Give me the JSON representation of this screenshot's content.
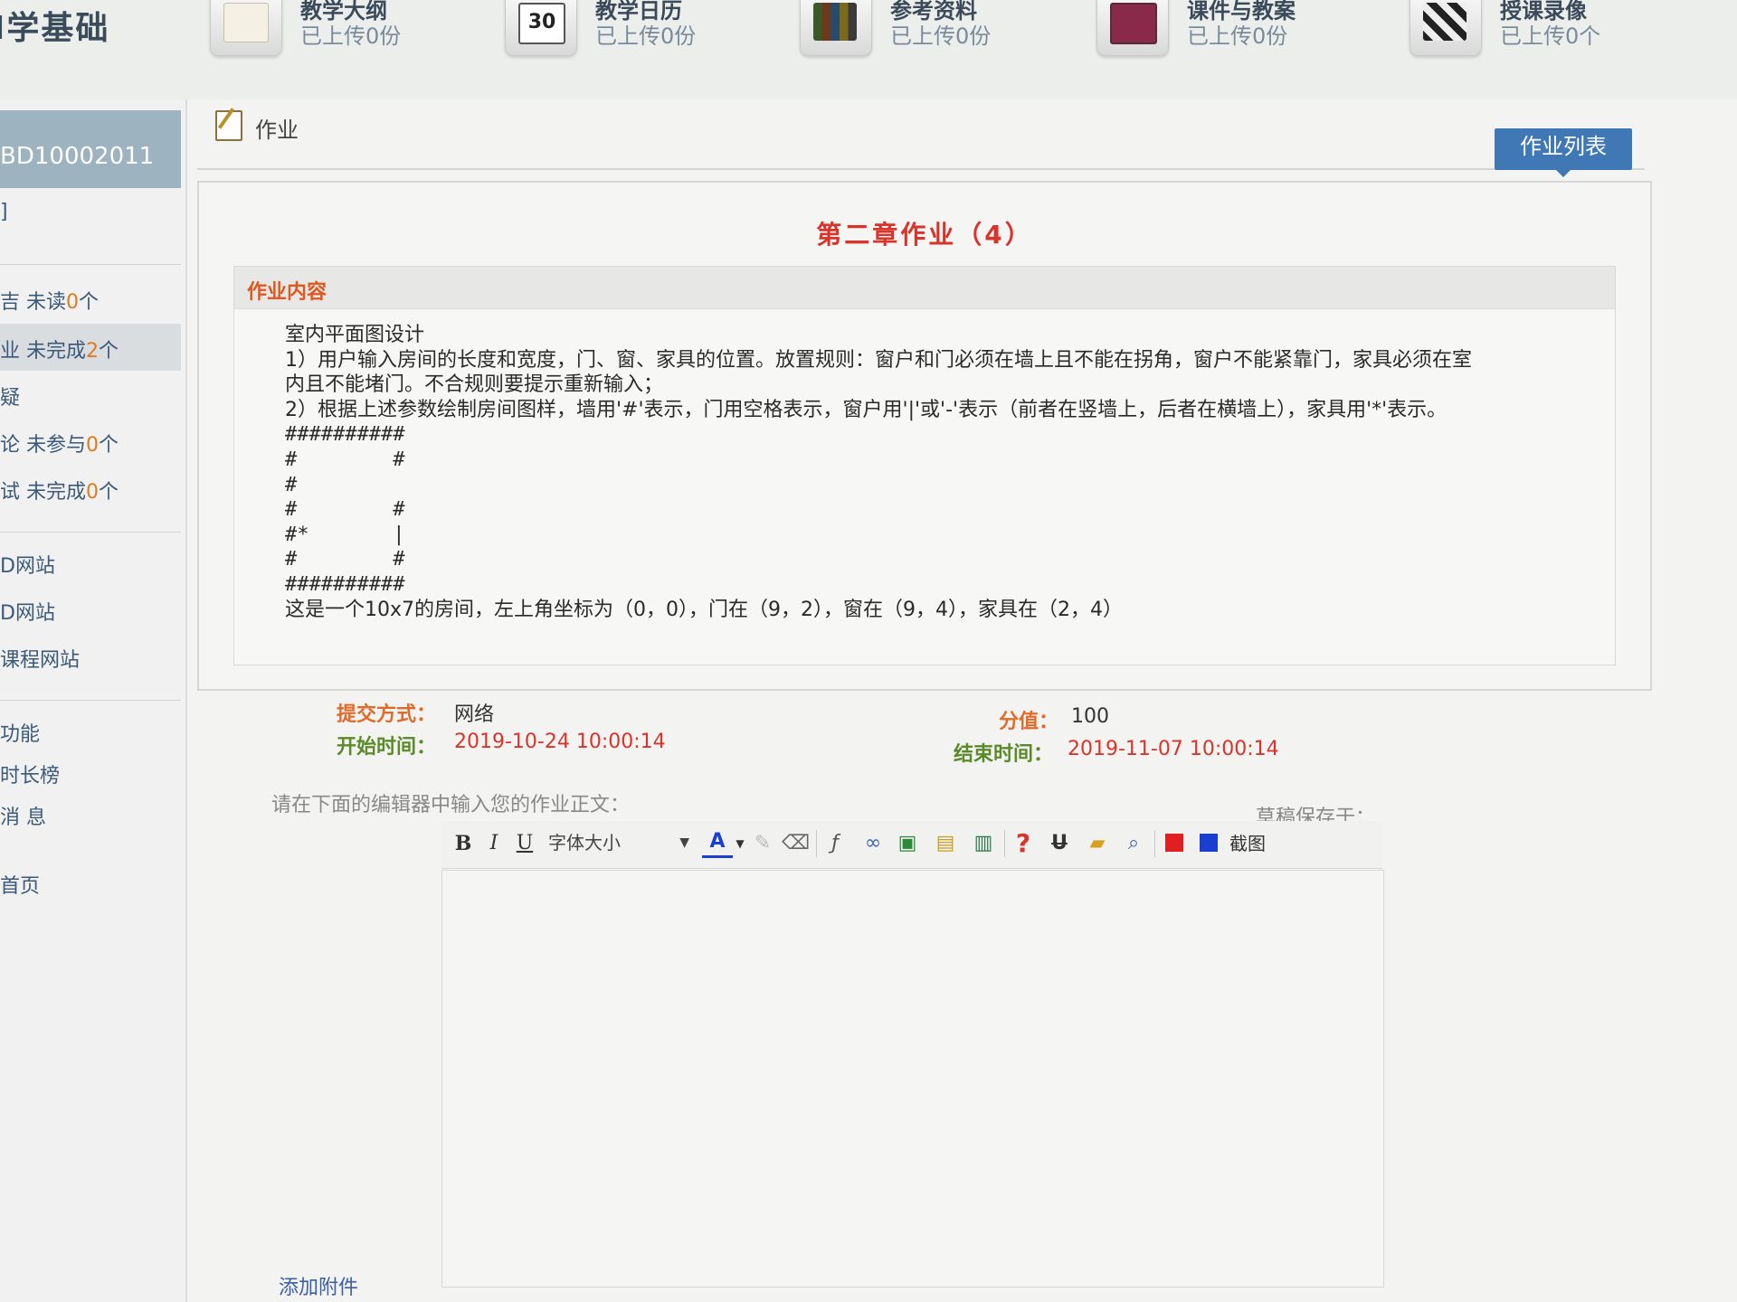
{
  "course_title": "I学基础",
  "resources": [
    {
      "name": "教学大纲",
      "count": "已上传0份",
      "icon": "syllabus-icon"
    },
    {
      "name": "教学日历",
      "count": "已上传0份",
      "icon": "calendar-icon",
      "icon_text": "30"
    },
    {
      "name": "参考资料",
      "count": "已上传0份",
      "icon": "bookshelf-icon"
    },
    {
      "name": "课件与教案",
      "count": "已上传0份",
      "icon": "courseware-icon"
    },
    {
      "name": "授课录像",
      "count": "已上传0个",
      "icon": "clapperboard-icon"
    }
  ],
  "sidebar": {
    "code": "BD10002011",
    "items": [
      {
        "label": "]"
      },
      {
        "label": "吉 未读",
        "num": "0",
        "unit": "个"
      },
      {
        "label": "业 未完成",
        "num": "2",
        "unit": "个"
      },
      {
        "label": "疑"
      },
      {
        "label": "论 未参与",
        "num": "0",
        "unit": "个"
      },
      {
        "label": "试 未完成",
        "num": "0",
        "unit": "个"
      },
      {
        "label": "D网站"
      },
      {
        "label": "D网站"
      },
      {
        "label": "课程网站"
      },
      {
        "label": "功能"
      },
      {
        "label": "时长榜"
      },
      {
        "label": "消 息"
      },
      {
        "label": "首页"
      }
    ]
  },
  "breadcrumb": {
    "label": "作业"
  },
  "list_button": "作业列表",
  "homework": {
    "title": "第二章作业（4）",
    "section_label": "作业内容",
    "lines": [
      "室内平面图设计",
      "1）用户输入房间的长度和宽度，门、窗、家具的位置。放置规则：窗户和门必须在墙上且不能在拐角，窗户不能紧靠门，家具必须在室",
      "内且不能堵门。不合规则要提示重新输入；",
      "2）根据上述参数绘制房间图样，墙用'#'表示，门用空格表示，窗户用'|'或'-'表示（前者在竖墙上，后者在横墙上），家具用'*'表示。",
      "##########",
      "#        #",
      "#",
      "#        #",
      "#*       |",
      "#        #",
      "##########",
      "这是一个10x7的房间，左上角坐标为（0，0），门在（9，2），窗在（9，4），家具在（2，4）"
    ]
  },
  "meta": {
    "submit_label": "提交方式：",
    "submit_value": "网络",
    "score_label": "分值：",
    "score_value": "100",
    "start_label": "开始时间：",
    "start_value": "2019-10-24 10:00:14",
    "end_label": "结束时间：",
    "end_value": "2019-11-07 10:00:14"
  },
  "editor": {
    "prompt": "请在下面的编辑器中输入您的作业正文：",
    "draft_label": "草稿保存于：",
    "font_size_label": "字体大小",
    "screenshot_label": "截图",
    "bold": "B",
    "italic": "I",
    "underline": "U",
    "font_color": "A",
    "help": "?",
    "strike": "U"
  },
  "attach_label": "添加附件",
  "colors": {
    "accent_blue": "#3f78b5",
    "title_red": "#d9342b",
    "label_orange": "#e06a2a",
    "label_green": "#5a8a2a",
    "count_orange": "#e07a1f",
    "swatch_red": "#e02020",
    "swatch_blue": "#1a3fd0"
  }
}
